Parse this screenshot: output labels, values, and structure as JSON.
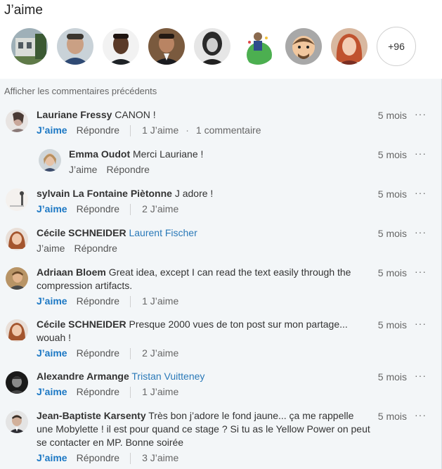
{
  "likes": {
    "title": "J’aime",
    "more_count": "+96",
    "avatars": [
      "liker-house",
      "liker-man-grey",
      "liker-man-dark",
      "liker-man-smile",
      "liker-woman-bw",
      "liker-cartoon-green",
      "liker-cartoon-face",
      "liker-woman-red"
    ]
  },
  "comments_header": {
    "show_previous": "Afficher les commentaires précédents"
  },
  "comments": [
    {
      "author": "Lauriane Fressy",
      "text": "CANON !",
      "mention": "",
      "time": "5 mois",
      "like_label": "J’aime",
      "like_active": true,
      "reply_label": "Répondre",
      "likes": "1 J’aime",
      "replies": "1 commentaire"
    },
    {
      "author": "Emma Oudot",
      "text": "Merci Lauriane !",
      "mention": "",
      "time": "5 mois",
      "like_label": "J’aime",
      "like_active": false,
      "reply_label": "Répondre",
      "likes": "",
      "replies": ""
    },
    {
      "author": "sylvain La Fontaine Piètonne",
      "text": "J adore !",
      "mention": "",
      "time": "5 mois",
      "like_label": "J’aime",
      "like_active": true,
      "reply_label": "Répondre",
      "likes": "2 J’aime",
      "replies": ""
    },
    {
      "author": "Cécile SCHNEIDER",
      "text": "",
      "mention": "Laurent Fischer",
      "time": "5 mois",
      "like_label": "J’aime",
      "like_active": false,
      "reply_label": "Répondre",
      "likes": "",
      "replies": ""
    },
    {
      "author": "Adriaan Bloem",
      "text": "Great idea, except I can read the text easily through the compression artifacts.",
      "mention": "",
      "time": "5 mois",
      "like_label": "J’aime",
      "like_active": true,
      "reply_label": "Répondre",
      "likes": "1 J’aime",
      "replies": ""
    },
    {
      "author": "Cécile SCHNEIDER",
      "text": "Presque 2000 vues de ton post sur mon partage... wouah !",
      "mention": "",
      "time": "5 mois",
      "like_label": "J’aime",
      "like_active": true,
      "reply_label": "Répondre",
      "likes": "2 J’aime",
      "replies": ""
    },
    {
      "author": "Alexandre Armange",
      "text": "",
      "mention": "Tristan Vuitteney",
      "time": "5 mois",
      "like_label": "J’aime",
      "like_active": true,
      "reply_label": "Répondre",
      "likes": "1 J’aime",
      "replies": ""
    },
    {
      "author": "Jean-Baptiste Karsenty",
      "text": "Très bon j’adore le fond jaune... ça me rappelle une Mobylette !  il est pour quand ce stage ? Si tu as le Yellow Power on peut se contacter en MP. Bonne soirée",
      "mention": "",
      "time": "5 mois",
      "like_label": "J’aime",
      "like_active": true,
      "reply_label": "Répondre",
      "likes": "3 J’aime",
      "replies": ""
    }
  ],
  "more_icon": "···"
}
